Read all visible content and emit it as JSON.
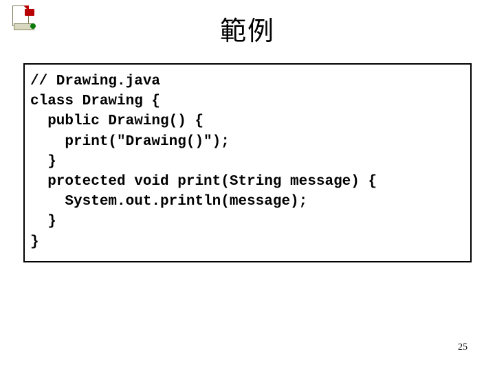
{
  "logo_alt": "document-with-seal logo",
  "title": "範例",
  "code": {
    "l1": "// Drawing.java",
    "l2": "class Drawing {",
    "l3": "  public Drawing() {",
    "l4": "    print(\"Drawing()\");",
    "l5": "  }",
    "l6": "  protected void print(String message) {",
    "l7": "    System.out.println(message);",
    "l8": "  }",
    "l9": "}"
  },
  "page_number": "25"
}
